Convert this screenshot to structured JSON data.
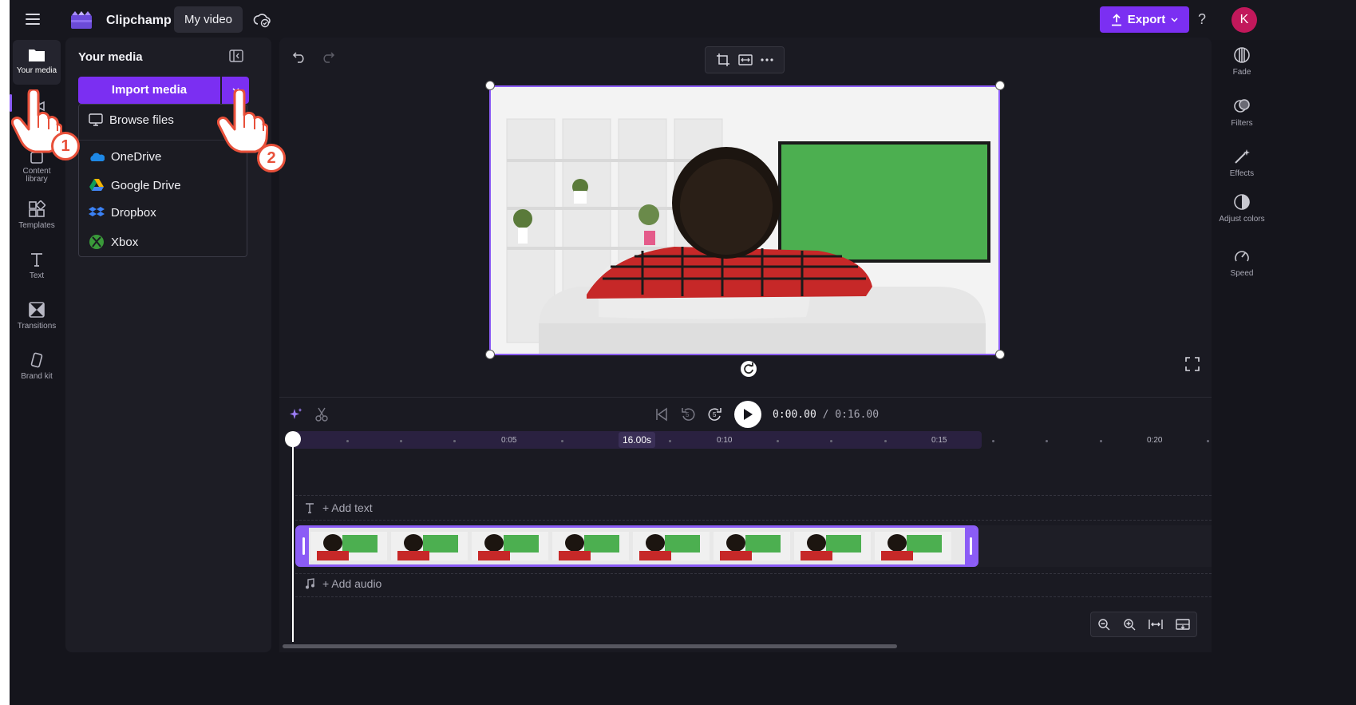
{
  "topbar": {
    "app_name": "Clipchamp",
    "project_title": "My video",
    "export_label": "Export",
    "help_glyph": "?",
    "avatar_initial": "K",
    "icons": [
      "hamburger-icon",
      "clipchamp-logo",
      "cloud-sync-icon",
      "upload-icon",
      "chevron-down-icon",
      "help-icon"
    ]
  },
  "left_rail": {
    "items": [
      {
        "label": "Your media",
        "icon": "folder-icon",
        "active": true
      },
      {
        "label": "Re",
        "icon": "record-icon"
      },
      {
        "label": "Content library",
        "icon": "content-library-icon"
      },
      {
        "label": "Templates",
        "icon": "templates-icon"
      },
      {
        "label": "Text",
        "icon": "text-icon"
      },
      {
        "label": "Transitions",
        "icon": "transitions-icon"
      },
      {
        "label": "Brand kit",
        "icon": "brand-kit-icon"
      }
    ]
  },
  "media_panel": {
    "title": "Your media",
    "import_label": "Import media",
    "dropdown": [
      {
        "label": "Browse files",
        "icon": "monitor-icon"
      },
      {
        "label": "OneDrive",
        "icon": "onedrive-icon"
      },
      {
        "label": "Google Drive",
        "icon": "google-drive-icon"
      },
      {
        "label": "Dropbox",
        "icon": "dropbox-icon"
      },
      {
        "label": "Xbox",
        "icon": "xbox-icon"
      }
    ]
  },
  "right_rail": {
    "items": [
      {
        "label": "Fade",
        "icon": "fade-icon"
      },
      {
        "label": "Filters",
        "icon": "filters-icon"
      },
      {
        "label": "Effects",
        "icon": "effects-icon"
      },
      {
        "label": "Adjust colors",
        "icon": "adjust-colors-icon"
      },
      {
        "label": "Speed",
        "icon": "speed-icon"
      }
    ]
  },
  "timeline": {
    "current_time": "0:00.00",
    "total_time": "/ 0:16.00",
    "duration_tag": "16.00s",
    "ruler_labels": [
      "0:05",
      "0:10",
      "0:15",
      "0:20"
    ],
    "skip_back_glyph": "5",
    "skip_fwd_glyph": "5",
    "add_text": "+ Add text",
    "add_audio": "+ Add audio"
  },
  "annotations": {
    "step1": "1",
    "step2": "2"
  },
  "colors": {
    "accent": "#7b2ff2",
    "accent_light": "#8b5cf6",
    "badge_ring": "#e8503a",
    "background": "#15151c"
  }
}
